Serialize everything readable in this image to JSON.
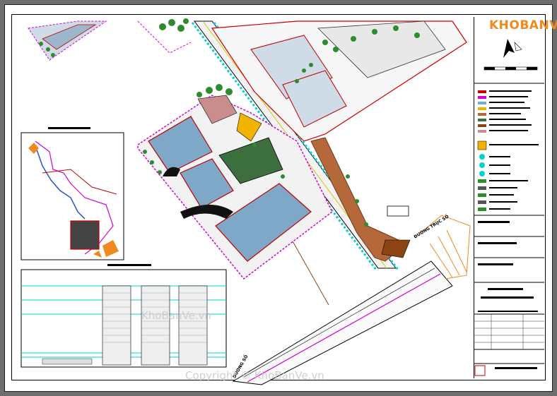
{
  "brand": {
    "name": "KHOBANVE"
  },
  "labels": {
    "road_east": "ĐƯỜNG TRỤC SỐ",
    "road_south": "ĐƯỜNG SỐ"
  },
  "watermarks": {
    "center": "KhoBanVe.vn",
    "bottom": "Copyright © KhoBanVe.vn"
  },
  "colors": {
    "brand": "#f08a1e",
    "road": "#00d2d2",
    "boundary": "#d400d4",
    "greenery": "#2e8b2e",
    "building": "#7fa7c7"
  }
}
